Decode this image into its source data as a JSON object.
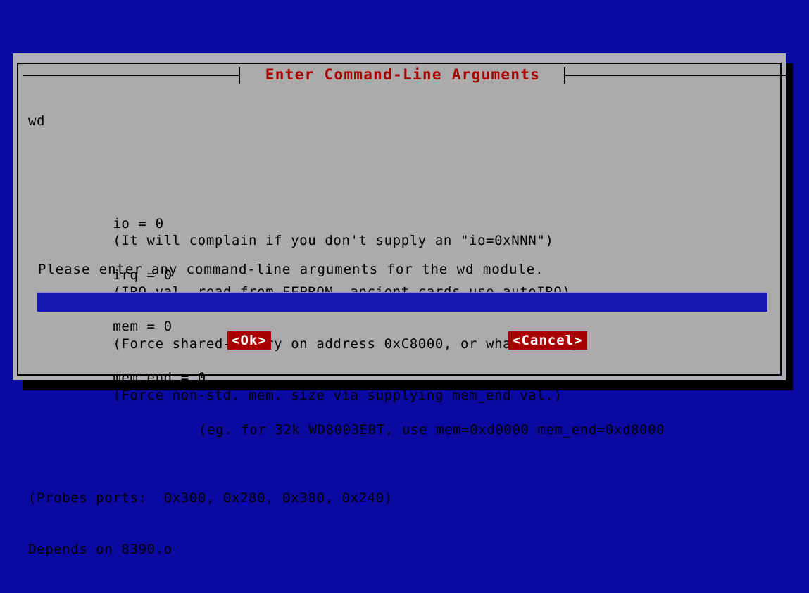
{
  "screen": {
    "background_color": "#0a0aa0"
  },
  "dialog": {
    "title": "Enter Command-Line Arguments",
    "title_color": "#a80000",
    "body_color": "#ababab",
    "module_name": "wd",
    "parameters": [
      {
        "key": "io = 0",
        "desc": "(It will complain if you don't supply an \"io=0xNNN\")"
      },
      {
        "key": "irq = 0",
        "desc": "(IRQ val. read from EEPROM, ancient cards use autoIRQ)"
      },
      {
        "key": "mem = 0",
        "desc": "(Force shared-memory on address 0xC8000, or whatever..)"
      },
      {
        "key": "mem_end = 0",
        "desc": "(Force non-std. mem. size via supplying mem_end val.)"
      }
    ],
    "continuation_line": "(eg. for 32k WD8003EBT, use mem=0xd0000 mem_end=0xd8000",
    "notes": [
      "(Probes ports:  0x300, 0x280, 0x380, 0x240)",
      "Depends on 8390.o"
    ],
    "prompt": "Please enter any command-line arguments for the wd module.",
    "input": {
      "value": "",
      "placeholder": "",
      "underline": "_______________________________________________________________________________________________",
      "background_color": "#1818b0",
      "text_color": "#ffffff"
    },
    "buttons": {
      "ok_label": "<Ok>",
      "cancel_label": "<Cancel>",
      "color": "#a80000"
    }
  }
}
